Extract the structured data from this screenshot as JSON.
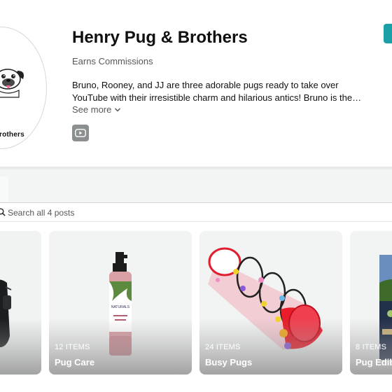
{
  "profile": {
    "avatar_text": "rothers",
    "name": "Henry Pug & Brothers",
    "subtitle": "Earns Commissions",
    "bio_lines": [
      "Bruno, Rooney, and JJ are three adorable pugs ready to take over",
      "YouTube with their irresistible charm and hilarious antics! Bruno is the…"
    ],
    "see_more": "See more",
    "social": [
      "youtube-icon"
    ]
  },
  "search": {
    "placeholder": "Search all 4 posts"
  },
  "collections": [
    {
      "count": "",
      "title": ""
    },
    {
      "count": "12 ITEMS",
      "title": "Pug Care"
    },
    {
      "count": "24 ITEMS",
      "title": "Busy Pugs"
    },
    {
      "count": "8 ITEMS",
      "title": "Pug Edib"
    }
  ],
  "colors": {
    "accent_teal": "#1aa0a5",
    "youtube_button": "#8b8f8f",
    "text_primary": "#0f1111",
    "text_secondary": "#565959"
  }
}
